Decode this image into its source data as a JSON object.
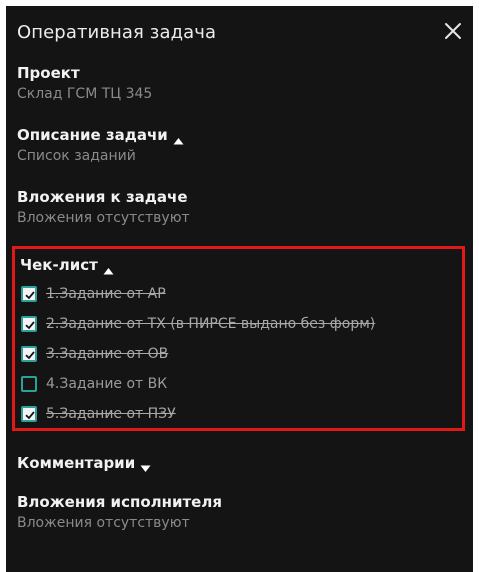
{
  "dialog": {
    "title": "Оперативная задача",
    "close_icon": "close-icon"
  },
  "project": {
    "label": "Проект",
    "value": "Склад ГСМ ТЦ 345"
  },
  "description": {
    "label": "Описание задачи",
    "value": "Список заданий",
    "expanded": true
  },
  "attachments": {
    "label": "Вложения к задаче",
    "value": "Вложения отсутствуют"
  },
  "checklist": {
    "label": "Чек-лист",
    "expanded": true,
    "highlight_color": "#e01818",
    "items": [
      {
        "text": "1.Задание от АР",
        "checked": true
      },
      {
        "text": "2.Задание от ТХ (в ПИРСЕ выдано без форм)",
        "checked": true
      },
      {
        "text": "3.Задание от ОВ",
        "checked": true
      },
      {
        "text": "4.Задание от ВК",
        "checked": false
      },
      {
        "text": "5.Задание от ПЗУ",
        "checked": true
      }
    ]
  },
  "comments": {
    "label": "Комментарии",
    "expanded": false
  },
  "executor_attachments": {
    "label": "Вложения исполнителя",
    "value": "Вложения отсутствуют"
  },
  "colors": {
    "background": "#141414",
    "accent": "#2ea09a"
  }
}
